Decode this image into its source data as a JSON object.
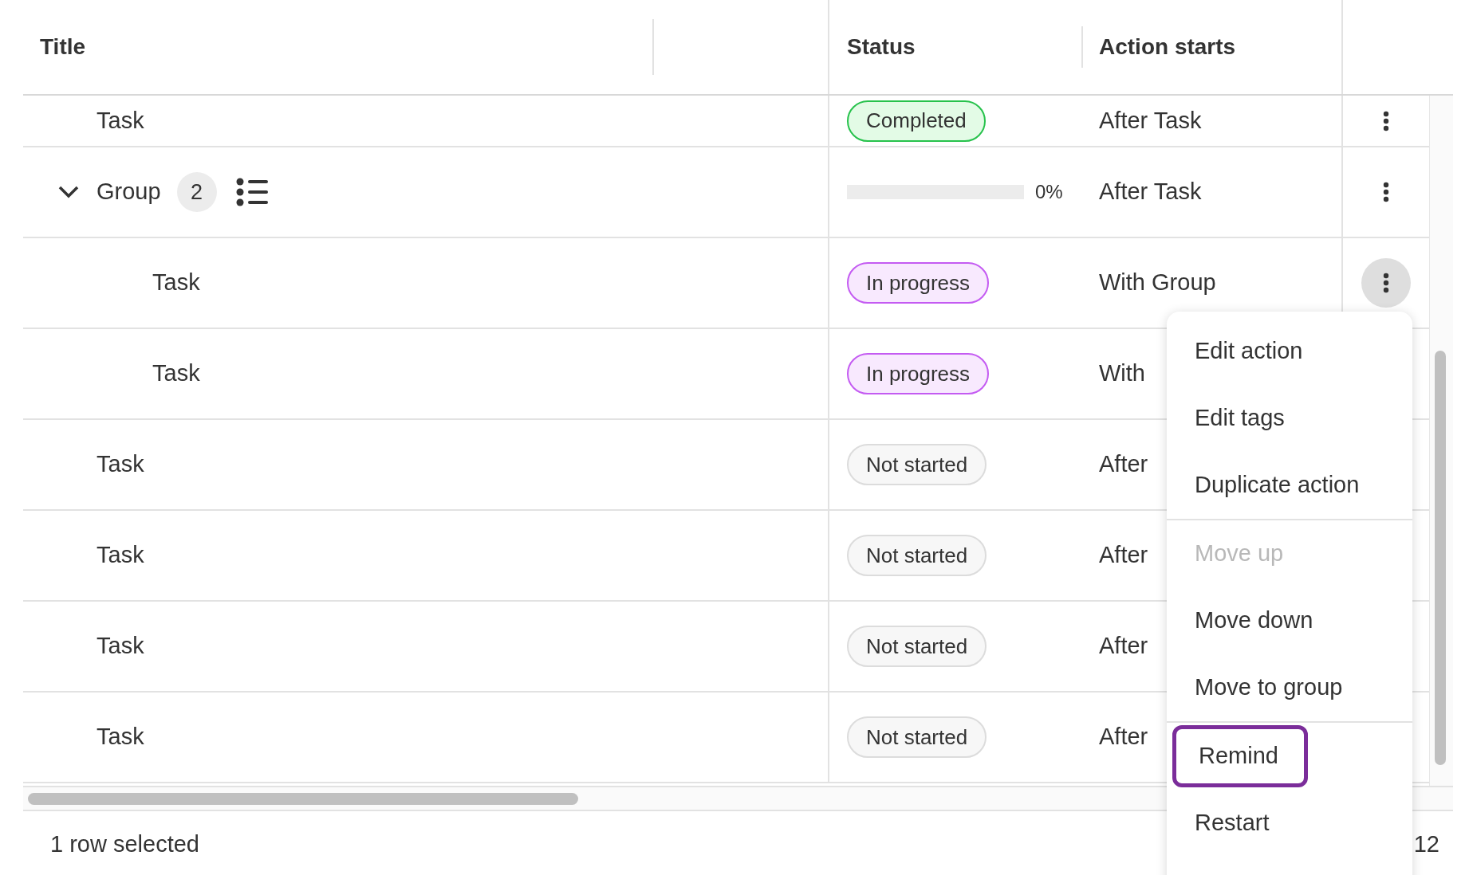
{
  "columns": [
    {
      "label": "Title"
    },
    {
      "label": "Status"
    },
    {
      "label": "Action starts"
    }
  ],
  "rows": [
    {
      "kind": "task",
      "title": "Task",
      "status": {
        "kind": "completed",
        "label": "Completed"
      },
      "starts": "After Task",
      "menu_open": false
    },
    {
      "kind": "group",
      "title": "Group",
      "count": "2",
      "expanded": true,
      "progress": {
        "level": 0,
        "label": "0%"
      },
      "starts": "After Task",
      "menu_open": false,
      "children": [
        {
          "kind": "task",
          "title": "Task",
          "status": {
            "kind": "in_progress",
            "label": "In progress"
          },
          "starts": "With Group",
          "menu_open": true
        },
        {
          "kind": "task",
          "title": "Task",
          "status": {
            "kind": "in_progress",
            "label": "In progress"
          },
          "starts": "With",
          "menu_open": false
        }
      ]
    },
    {
      "kind": "task",
      "title": "Task",
      "status": {
        "kind": "not_started",
        "label": "Not started"
      },
      "starts": "After"
    },
    {
      "kind": "task",
      "title": "Task",
      "status": {
        "kind": "not_started",
        "label": "Not started"
      },
      "starts": "After"
    },
    {
      "kind": "task",
      "title": "Task",
      "status": {
        "kind": "not_started",
        "label": "Not started"
      },
      "starts": "After"
    },
    {
      "kind": "task",
      "title": "Task",
      "status": {
        "kind": "not_started",
        "label": "Not started"
      },
      "starts": "After"
    }
  ],
  "menu": {
    "sections": [
      [
        {
          "label": "Edit action",
          "disabled": false,
          "focused": false
        },
        {
          "label": "Edit tags",
          "disabled": false,
          "focused": false
        },
        {
          "label": "Duplicate action",
          "disabled": false,
          "focused": false
        }
      ],
      [
        {
          "label": "Move up",
          "disabled": true,
          "focused": false
        },
        {
          "label": "Move down",
          "disabled": false,
          "focused": false
        },
        {
          "label": "Move to group",
          "disabled": false,
          "focused": false
        }
      ],
      [
        {
          "label": "Remind",
          "disabled": false,
          "focused": true
        },
        {
          "label": "Restart",
          "disabled": false,
          "focused": false
        }
      ]
    ]
  },
  "footer": {
    "selection": "1 row selected",
    "page_info": "12"
  }
}
